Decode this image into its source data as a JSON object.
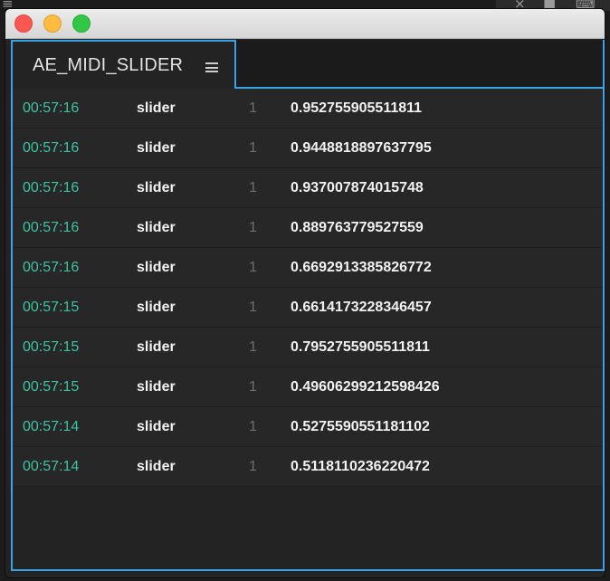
{
  "panel": {
    "tab_label": "AE_MIDI_SLIDER"
  },
  "colors": {
    "accent": "#3aa2e6",
    "timestamp": "#3cc2a4",
    "close": "#fc5753",
    "minimize": "#fdbc40",
    "maximize": "#33c748"
  },
  "messages": [
    {
      "time": "00:57:16",
      "name": "slider",
      "channel": "1",
      "value": "0.952755905511811"
    },
    {
      "time": "00:57:16",
      "name": "slider",
      "channel": "1",
      "value": "0.9448818897637795"
    },
    {
      "time": "00:57:16",
      "name": "slider",
      "channel": "1",
      "value": "0.937007874015748"
    },
    {
      "time": "00:57:16",
      "name": "slider",
      "channel": "1",
      "value": "0.889763779527559"
    },
    {
      "time": "00:57:16",
      "name": "slider",
      "channel": "1",
      "value": "0.6692913385826772"
    },
    {
      "time": "00:57:15",
      "name": "slider",
      "channel": "1",
      "value": "0.6614173228346457"
    },
    {
      "time": "00:57:15",
      "name": "slider",
      "channel": "1",
      "value": "0.7952755905511811"
    },
    {
      "time": "00:57:15",
      "name": "slider",
      "channel": "1",
      "value": "0.49606299212598426"
    },
    {
      "time": "00:57:14",
      "name": "slider",
      "channel": "1",
      "value": "0.5275590551181102"
    },
    {
      "time": "00:57:14",
      "name": "slider",
      "channel": "1",
      "value": "0.5118110236220472"
    }
  ]
}
